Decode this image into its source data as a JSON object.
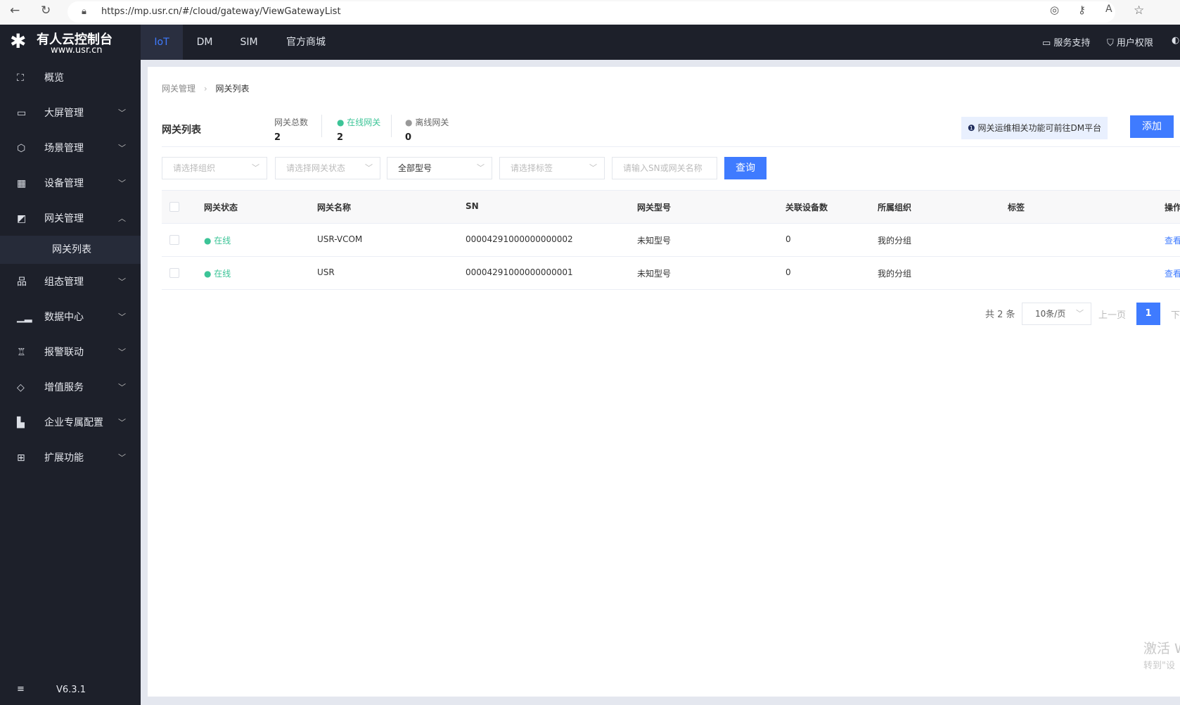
{
  "browser": {
    "url": "https://mp.usr.cn/#/cloud/gateway/ViewGatewayList"
  },
  "brand": {
    "name": "有人云控制台",
    "site": "www.usr.cn"
  },
  "topnav": {
    "tabs": [
      "IoT",
      "DM",
      "SIM",
      "官方商城"
    ],
    "active": "IoT",
    "support": "服务支持",
    "permission": "用户权限"
  },
  "sidebar": {
    "items": [
      {
        "label": "概览",
        "icon": "overview-icon"
      },
      {
        "label": "大屏管理",
        "icon": "screen-icon"
      },
      {
        "label": "场景管理",
        "icon": "scene-icon"
      },
      {
        "label": "设备管理",
        "icon": "device-icon"
      },
      {
        "label": "网关管理",
        "icon": "gateway-icon",
        "expanded": true
      },
      {
        "label": "组态管理",
        "icon": "config-icon"
      },
      {
        "label": "数据中心",
        "icon": "chart-icon"
      },
      {
        "label": "报警联动",
        "icon": "alarm-icon"
      },
      {
        "label": "增值服务",
        "icon": "diamond-icon"
      },
      {
        "label": "企业专属配置",
        "icon": "building-icon"
      },
      {
        "label": "扩展功能",
        "icon": "grid-icon"
      }
    ],
    "subitem": "网关列表",
    "version": "V6.3.1"
  },
  "breadcrumb": [
    "网关管理",
    "网关列表"
  ],
  "header": {
    "title": "网关列表",
    "stats": [
      {
        "label": "网关总数",
        "value": "2"
      },
      {
        "label": "在线网关",
        "value": "2"
      },
      {
        "label": "离线网关",
        "value": "0"
      }
    ],
    "notice": "网关运维相关功能可前往DM平台",
    "add": "添加"
  },
  "filters": {
    "org": "请选择组织",
    "status": "请选择网关状态",
    "model": "全部型号",
    "tag": "请选择标签",
    "search": "请输入SN或网关名称",
    "query": "查询"
  },
  "table": {
    "columns": [
      "网关状态",
      "网关名称",
      "SN",
      "网关型号",
      "关联设备数",
      "所属组织",
      "标签",
      "操作"
    ],
    "rows": [
      {
        "status": "在线",
        "name": "USR-VCOM",
        "sn": "00004291000000000002",
        "model": "未知型号",
        "count": "0",
        "org": "我的分组",
        "tag": "",
        "action": "查看"
      },
      {
        "status": "在线",
        "name": "USR",
        "sn": "00004291000000000001",
        "model": "未知型号",
        "count": "0",
        "org": "我的分组",
        "tag": "",
        "action": "查看"
      }
    ]
  },
  "pagination": {
    "total": "共 2 条",
    "page_size": "10条/页",
    "prev": "上一页",
    "current": "1",
    "next": "下"
  },
  "watermark": {
    "line1": "激活 W",
    "line2": "转到\"设"
  },
  "colors": {
    "accent": "#3f7bff",
    "online": "#3cc497",
    "sidebar": "#1d202a"
  }
}
